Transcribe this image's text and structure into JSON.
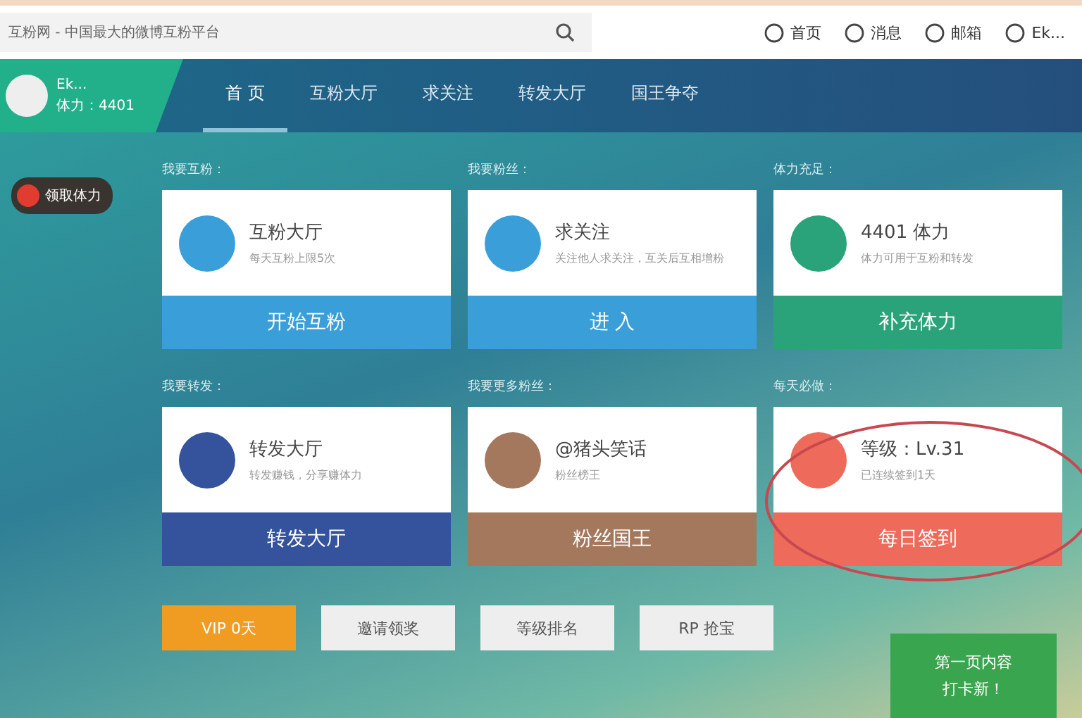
{
  "topbar": {
    "search": {
      "value": "互粉网 - 中国最大的微博互粉平台"
    },
    "links": [
      {
        "label": "首页"
      },
      {
        "label": "消息"
      },
      {
        "label": "邮箱"
      },
      {
        "label": "Ek..."
      }
    ]
  },
  "profile": {
    "name": "Ek...",
    "stamina": "体力：4401"
  },
  "nav": [
    {
      "label": "首 页",
      "selected": true
    },
    {
      "label": "互粉大厅",
      "selected": false
    },
    {
      "label": "求关注",
      "selected": false
    },
    {
      "label": "转发大厅",
      "selected": false
    },
    {
      "label": "国王争夺",
      "selected": false
    }
  ],
  "side_badge": {
    "label": "领取体力"
  },
  "cards": [
    {
      "section": "我要互粉：",
      "title": "互粉大厅",
      "desc": "每天互粉上限5次",
      "button": "开始互粉",
      "color": "#3a9fd8"
    },
    {
      "section": "我要粉丝：",
      "title": "求关注",
      "desc": "关注他人求关注，互关后互相增粉",
      "button": "进 入",
      "color": "#3a9fd8"
    },
    {
      "section": "体力充足：",
      "title": "4401 体力",
      "desc": "体力可用于互粉和转发",
      "button": "补充体力",
      "color": "#2aa37a"
    },
    {
      "section": "我要转发：",
      "title": "转发大厅",
      "desc": "转发赚钱，分享赚体力",
      "button": "转发大厅",
      "color": "#34539c"
    },
    {
      "section": "我要更多粉丝：",
      "title": "@猪头笑话",
      "desc": "粉丝榜王",
      "button": "粉丝国王",
      "color": "#a3785c"
    },
    {
      "section": "每天必做：",
      "title": "等级：Lv.31",
      "desc": "已连续签到1天",
      "button": "每日签到",
      "color": "#ee6b5b"
    }
  ],
  "bottom_buttons": [
    {
      "label": "VIP 0天",
      "kind": "primary"
    },
    {
      "label": "邀请领奖",
      "kind": "plain"
    },
    {
      "label": "等级排名",
      "kind": "plain"
    },
    {
      "label": "RP 抢宝",
      "kind": "plain"
    }
  ],
  "promo": {
    "line1": "第一页内容",
    "line2": "打卡新！"
  }
}
